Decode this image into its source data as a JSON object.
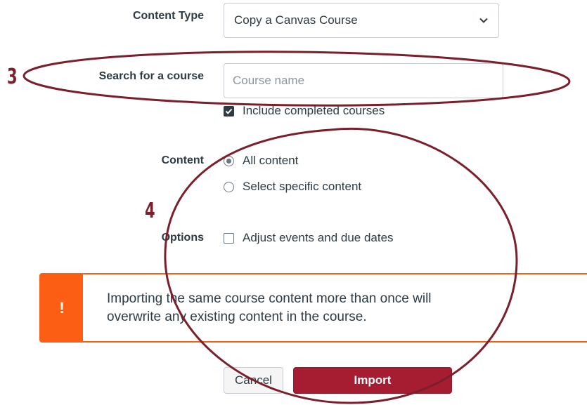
{
  "form": {
    "content_type_label": "Content Type",
    "content_type_value": "Copy a Canvas Course",
    "search_label": "Search for a course",
    "search_placeholder": "Course name",
    "include_completed_label": "Include completed courses",
    "include_completed_checked": true,
    "content_label": "Content",
    "content_options": [
      {
        "label": "All content",
        "selected": true
      },
      {
        "label": "Select specific content",
        "selected": false
      }
    ],
    "options_label": "Options",
    "adjust_dates_label": "Adjust events and due dates",
    "adjust_dates_checked": false
  },
  "alert": {
    "icon": "!",
    "message_line1": "Importing the same course content more than once will",
    "message_line2": "overwrite any existing content in the course.",
    "color": "#fc5e13"
  },
  "actions": {
    "cancel_label": "Cancel",
    "import_label": "Import",
    "import_color": "#a61d32"
  },
  "annotations": {
    "step3": "3",
    "step4": "4",
    "color": "#7a1f2b"
  }
}
